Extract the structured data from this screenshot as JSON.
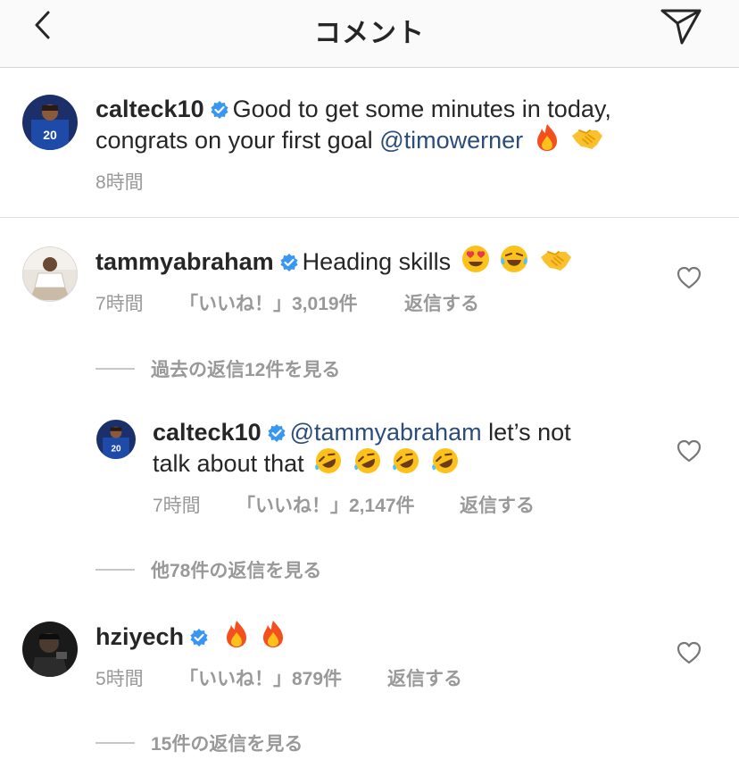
{
  "header": {
    "title": "コメント"
  },
  "post": {
    "username": "calteck10",
    "text_1": "Good to get some minutes in today,",
    "text_2": "congrats on your first goal",
    "mention": "@timowerner",
    "emojis": [
      "fire-emoji",
      "handshake-emoji"
    ],
    "time": "8時間"
  },
  "comments": [
    {
      "username": "tammyabraham",
      "text": "Heading skills",
      "emojis": [
        "heart-eyes-emoji",
        "joy-emoji",
        "handshake-emoji"
      ],
      "time": "7時間",
      "likes": "「いいね！」3,019件",
      "reply": "返信する",
      "view_replies": "過去の返信12件を見る"
    },
    {
      "username": "calteck10",
      "mention": "@tammyabraham",
      "text_1": "let’s not",
      "text_2": "talk about that",
      "emojis": [
        "rofl-emoji",
        "rofl-emoji",
        "rofl-emoji",
        "rofl-emoji"
      ],
      "time": "7時間",
      "likes": "「いいね！」2,147件",
      "reply": "返信する",
      "view_replies": "他78件の返信を見る"
    },
    {
      "username": "hziyech",
      "emojis": [
        "fire-emoji",
        "fire-emoji"
      ],
      "time": "5時間",
      "likes": "「いいね！」879件",
      "reply": "返信する",
      "view_replies": "15件の返信を見る"
    }
  ],
  "colors": {
    "mention": "#2a4d7c",
    "meta": "#999999",
    "verified": "#3897f0",
    "text": "#262626"
  },
  "icons": {
    "back": "chevron-left-icon",
    "send": "paper-plane-icon",
    "like": "heart-outline-icon",
    "verified": "verified-badge-icon"
  }
}
